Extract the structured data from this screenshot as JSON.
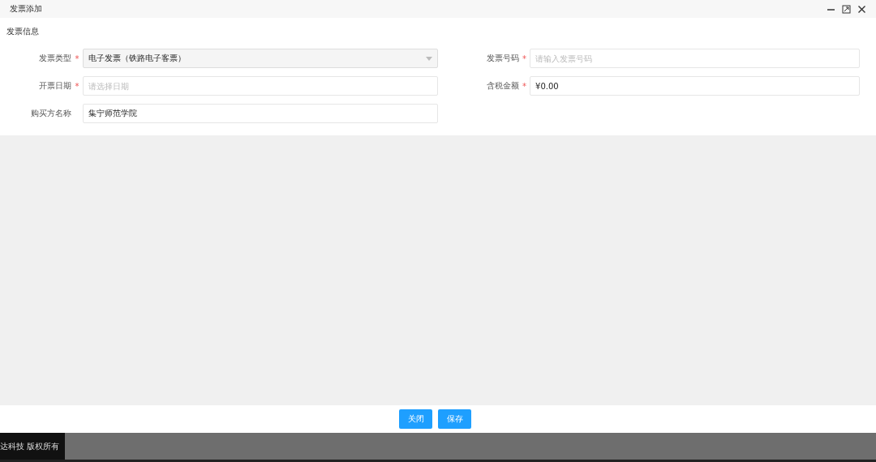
{
  "window": {
    "title": "发票添加"
  },
  "section": {
    "title": "发票信息"
  },
  "fields": [
    {
      "label": "发票类型",
      "required_mark": "*",
      "kind": "select",
      "value": "电子发票（铁路电子客票）"
    },
    {
      "label": "发票号码",
      "required_mark": "*",
      "kind": "text",
      "placeholder": "请输入发票号码"
    },
    {
      "label": "开票日期",
      "required_mark": "*",
      "kind": "text",
      "placeholder": "请选择日期"
    },
    {
      "label": "含税金额",
      "required_mark": "*",
      "kind": "text",
      "value": "¥0.00"
    },
    {
      "label": "购买方名称",
      "kind": "text",
      "value": "集宁师范学院"
    }
  ],
  "buttons": [
    "关闭",
    "保存"
  ],
  "footer": {
    "copyright": "达科技 版权所有"
  }
}
